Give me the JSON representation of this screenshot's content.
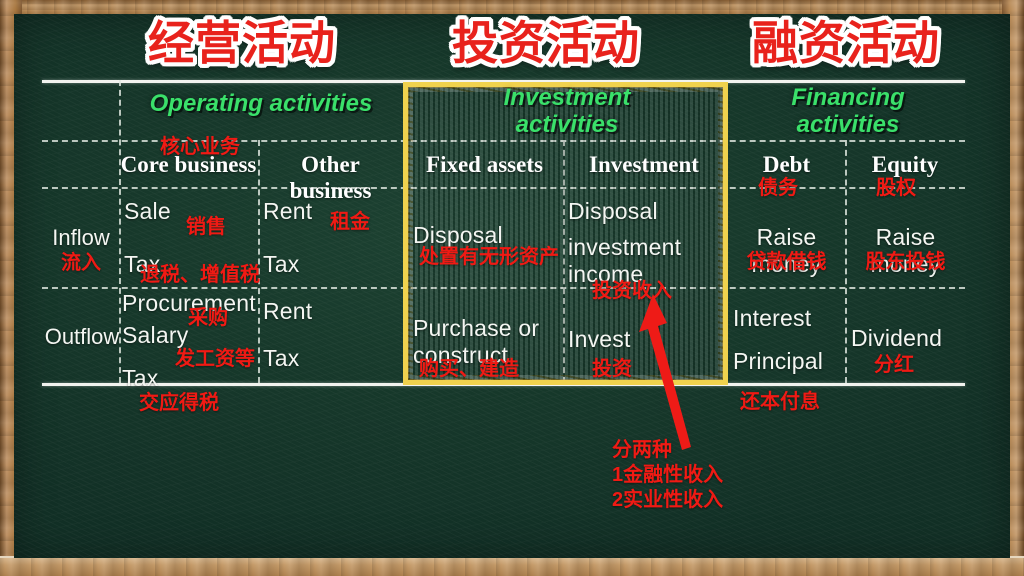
{
  "headlines": [
    {
      "id": "operating",
      "text": "经营活动"
    },
    {
      "id": "investment",
      "text": "投资活动"
    },
    {
      "id": "financing",
      "text": "融资活动"
    }
  ],
  "groups": [
    {
      "id": "operating",
      "label": "Operating activities"
    },
    {
      "id": "investment",
      "label": "Investment\nactivities",
      "line1": "Investment",
      "line2": "activities"
    },
    {
      "id": "financing",
      "label": "Financing\nactivities",
      "line1": "Financing",
      "line2": "activities"
    }
  ],
  "columns": [
    {
      "id": "core-business",
      "en": "Core business",
      "cn": "核心业务"
    },
    {
      "id": "other-business",
      "en": "Other business",
      "cn": ""
    },
    {
      "id": "fixed-assets",
      "en": "Fixed assets",
      "cn": ""
    },
    {
      "id": "investment",
      "en": "Investment",
      "cn": ""
    },
    {
      "id": "debt",
      "en": "Debt",
      "cn": "债务"
    },
    {
      "id": "equity",
      "en": "Equity",
      "cn": "股权"
    }
  ],
  "rows": [
    {
      "id": "inflow",
      "en": "Inflow",
      "cn": "流入"
    },
    {
      "id": "outflow",
      "en": "Outflow",
      "cn": ""
    }
  ],
  "cells": {
    "inflow_core": {
      "en": [
        "Sale",
        "Tax"
      ],
      "cn": [
        "销售",
        "退税、增值税"
      ]
    },
    "inflow_other": {
      "en": [
        "Rent",
        "Tax"
      ],
      "cn": [
        "租金"
      ]
    },
    "inflow_fixed": {
      "en": [
        "Disposal"
      ],
      "cn": [
        "处置有无形资产"
      ]
    },
    "inflow_invest": {
      "en": [
        "Disposal",
        "investment",
        "income"
      ],
      "cn": [
        "投资收入"
      ]
    },
    "inflow_debt": {
      "en": [
        "Raise money"
      ],
      "cn": [
        "贷款借钱"
      ]
    },
    "inflow_equity": {
      "en": [
        "Raise money"
      ],
      "cn": [
        "股东投钱"
      ]
    },
    "outflow_core": {
      "en": [
        "Procurement",
        "Salary",
        "Tax"
      ],
      "cn": [
        "采购",
        "发工资等",
        "交应得税"
      ]
    },
    "outflow_other": {
      "en": [
        "Rent",
        "Tax"
      ],
      "cn": []
    },
    "outflow_fixed": {
      "en": [
        "Purchase or",
        "construct"
      ],
      "cn": [
        "购买、建造"
      ]
    },
    "outflow_invest": {
      "en": [
        "Invest"
      ],
      "cn": [
        "投资"
      ]
    },
    "outflow_debt": {
      "en": [
        "Interest",
        "Principal"
      ],
      "cn": [
        "还本付息"
      ]
    },
    "outflow_equity": {
      "en": [
        "Dividend"
      ],
      "cn": [
        "分红"
      ]
    }
  },
  "annotation": {
    "id": "investment-income-note",
    "lines": [
      "分两种",
      "1金融性收入",
      "2实业性收入"
    ]
  },
  "colors": {
    "board": "#17392b",
    "chalk_white": "#f4f6f2",
    "chalk_green": "#3ae06a",
    "chalk_red": "#f01a14",
    "highlight_yellow": "#f0d24e",
    "headline_red": "#e8221c",
    "wood": "#b5854f"
  }
}
